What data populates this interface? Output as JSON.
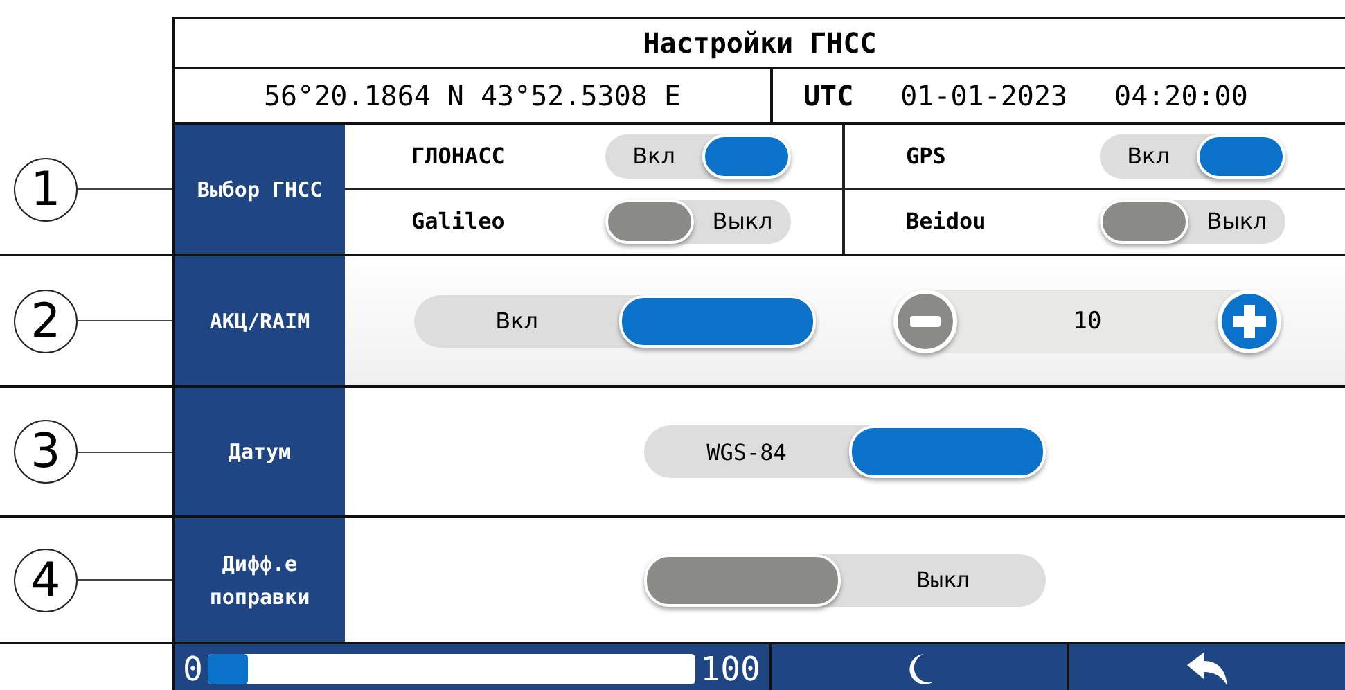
{
  "title": "Настройки ГНСС",
  "position": "56°20.1864 N 43°52.5308 E",
  "utc_label": "UTC",
  "date": "01-01-2023",
  "time": "04:20:00",
  "sections": [
    {
      "kind": "systems",
      "callout": "1",
      "label": "Выбор ГНСС",
      "systems": [
        {
          "name": "ГЛОНАСС",
          "switch": {
            "label": "Вкл",
            "on": true
          }
        },
        {
          "name": "GPS",
          "switch": {
            "label": "Вкл",
            "on": true
          }
        },
        {
          "name": "Galileo",
          "switch": {
            "label": "Выкл",
            "on": false
          }
        },
        {
          "name": "Beidou",
          "switch": {
            "label": "Выкл",
            "on": false
          }
        }
      ]
    },
    {
      "kind": "toggle_stepper",
      "callout": "2",
      "label": "АКЦ/RAIM",
      "switch": {
        "label": "Вкл",
        "on": true
      },
      "stepper": {
        "value": "10"
      }
    },
    {
      "kind": "toggle",
      "callout": "3",
      "label": "Датум",
      "switch": {
        "label": "WGS-84",
        "on": true
      }
    },
    {
      "kind": "toggle",
      "callout": "4",
      "label": "Дифф.е поправки",
      "switch": {
        "label": "Выкл",
        "on": false
      }
    }
  ],
  "footer": {
    "min": "0",
    "max": "100",
    "brightness": {
      "level": 0.08
    }
  }
}
